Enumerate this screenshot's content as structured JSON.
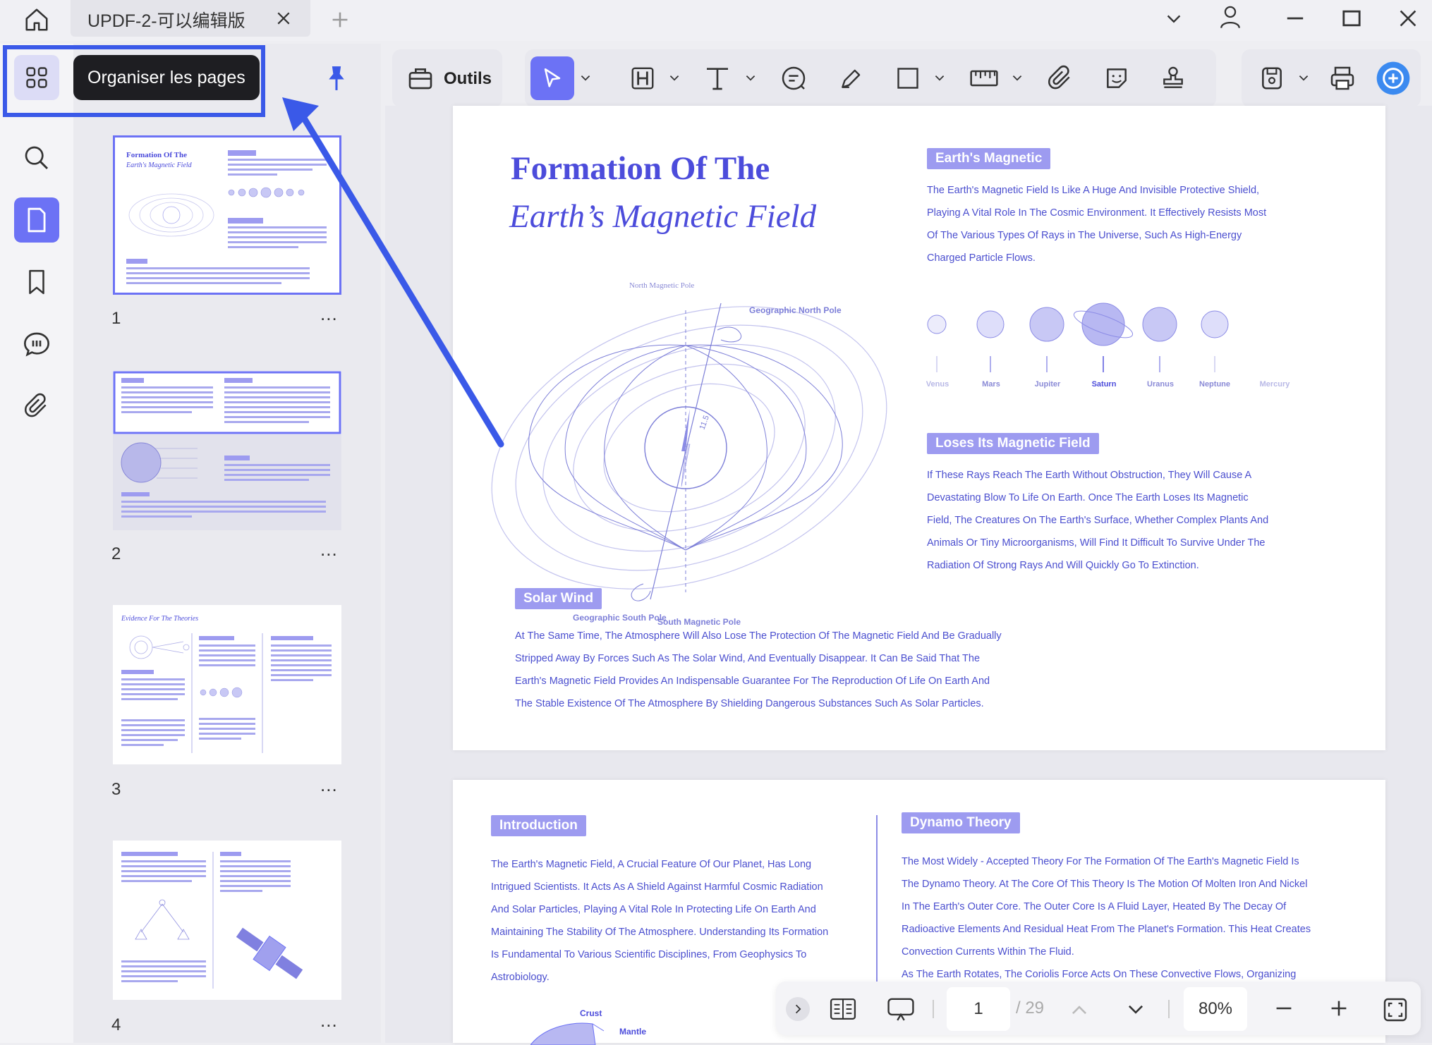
{
  "window": {
    "tab_title": "UPDF-2-可以编辑版"
  },
  "left_panel": {
    "tooltip": "Organiser les pages",
    "thumbnails": [
      {
        "number": "1",
        "more": "..."
      },
      {
        "number": "2",
        "more": "..."
      },
      {
        "number": "3",
        "more": "..."
      },
      {
        "number": "4",
        "more": "..."
      }
    ],
    "thumb3_title": "Evidence For The Theories",
    "thumb1_title_line1": "Formation Of The",
    "thumb1_title_line2": "Earth's Magnetic Field"
  },
  "toolbar": {
    "tools_label": "Outils"
  },
  "page1": {
    "title_line1": "Formation Of The",
    "title_line2": "Earth’s Magnetic Field",
    "diagram_labels": {
      "north_magnetic_pole": "North Magnetic Pole",
      "geographic_north": "Geographic North Pole",
      "angle": "11.5",
      "geographic_south": "Geographic South Pole",
      "south_magnetic": "South Magnetic Pole"
    },
    "section1_header": "Earth's Magnetic",
    "section1_text": [
      "The Earth's Magnetic Field Is Like A Huge And Invisible Protective Shield,",
      "Playing A Vital Role In The Cosmic Environment. It Effectively Resists Most",
      "Of The Various Types Of Rays in The Universe, Such As High-Energy",
      "Charged Particle Flows."
    ],
    "planets": [
      "Venus",
      "Mars",
      "Jupiter",
      "Saturn",
      "Uranus",
      "Neptune",
      "Mercury"
    ],
    "section2_header": "Loses Its Magnetic Field",
    "section2_text": [
      "If These Rays Reach The Earth Without Obstruction, They Will Cause A",
      "Devastating Blow To Life On Earth. Once The Earth Loses Its Magnetic",
      "Field, The Creatures On The Earth's Surface, Whether Complex Plants And",
      "Animals Or Tiny Microorganisms, Will Find It Difficult To Survive Under The",
      "Radiation Of Strong Rays And Will Quickly Go To Extinction."
    ],
    "section3_header": "Solar Wind",
    "section3_text": [
      "At The Same Time, The Atmosphere Will Also Lose The Protection Of The Magnetic Field And Be Gradually",
      "Stripped Away By Forces Such As The Solar Wind, And Eventually Disappear. It Can Be Said That The",
      "Earth's Magnetic Field Provides An Indispensable Guarantee For The Reproduction Of Life On Earth And",
      "The Stable Existence Of The Atmosphere By Shielding Dangerous Substances Such As Solar Particles."
    ]
  },
  "page2": {
    "intro_header": "Introduction",
    "intro_text": [
      "The Earth's Magnetic Field, A Crucial Feature Of Our Planet, Has Long",
      "Intrigued Scientists. It Acts As A Shield Against Harmful Cosmic Radiation",
      "And Solar Particles, Playing A Vital Role In Protecting Life On Earth And",
      "Maintaining The Stability Of The Atmosphere. Understanding Its Formation",
      "Is Fundamental To Various Scientific Disciplines, From Geophysics To",
      "Astrobiology."
    ],
    "dynamo_header": "Dynamo Theory",
    "dynamo_text": [
      "The Most Widely - Accepted Theory For The Formation Of The Earth's Magnetic Field Is",
      "The Dynamo Theory. At The Core Of This Theory Is The Motion Of Molten Iron And Nickel",
      "In The Earth's Outer Core. The Outer Core Is A Fluid Layer, Heated By The Decay Of",
      "Radioactive Elements And Residual Heat From The Planet's Formation. This Heat Creates",
      "Convection Currents Within The Fluid.",
      "As The Earth Rotates, The Coriolis Force Acts On These Convective Flows, Organizing"
    ],
    "crust_label": "Crust",
    "mantle_label": "Mantle"
  },
  "bottom_bar": {
    "current_page": "1",
    "total_pages": "/ 29",
    "zoom": "80%"
  },
  "colors": {
    "accent": "#3a59e8",
    "tool_active": "#6c72f5",
    "doc_text": "#4b4fcf",
    "header_bg": "#9d9bf0"
  }
}
